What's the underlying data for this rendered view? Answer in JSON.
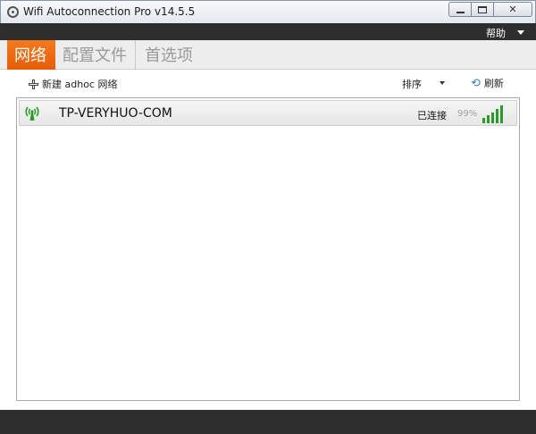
{
  "window": {
    "title": "Wifi Autoconnection Pro v14.5.5",
    "controls": [
      "minimize",
      "maximize",
      "close"
    ]
  },
  "menu": {
    "help_label": "帮助"
  },
  "tabs": [
    {
      "label": "网络",
      "active": true
    },
    {
      "label": "配置文件",
      "active": false
    },
    {
      "label": "首选项",
      "active": false
    }
  ],
  "toolbar": {
    "add_label": "新建 adhoc 网络",
    "sort_label": "排序",
    "refresh_label": "刷新"
  },
  "networks": [
    {
      "ssid": "TP-VERYHUO-COM",
      "status": "已连接",
      "signal_text": "99%",
      "signal_bars": 5,
      "icon": "wifi-antenna-icon"
    }
  ],
  "colors": {
    "accent": "#f26b12",
    "signal": "#2a9a2a",
    "dark_bar": "#2e2e2e"
  }
}
